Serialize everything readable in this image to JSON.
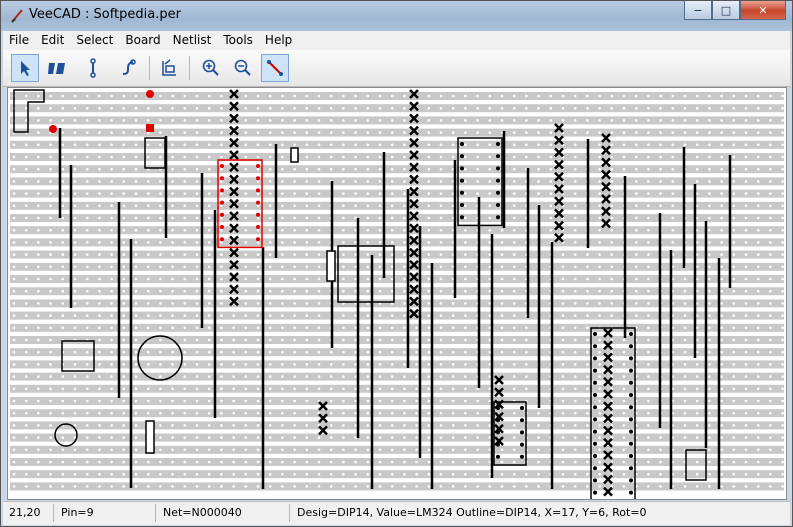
{
  "window": {
    "title": "VeeCAD : Softpedia.per"
  },
  "menu": [
    {
      "name": "menu-file",
      "label": "File"
    },
    {
      "name": "menu-edit",
      "label": "Edit"
    },
    {
      "name": "menu-select",
      "label": "Select"
    },
    {
      "name": "menu-board",
      "label": "Board"
    },
    {
      "name": "menu-netlist",
      "label": "Netlist"
    },
    {
      "name": "menu-tools",
      "label": "Tools"
    },
    {
      "name": "menu-help",
      "label": "Help"
    }
  ],
  "toolbar": {
    "tools": [
      "select-arrow-icon",
      "strip-break-icon",
      "link-icon",
      "wire-icon",
      "board-icon",
      "zoom-in-icon",
      "zoom-out-icon",
      "net-trace-icon"
    ],
    "active": "net-trace-icon"
  },
  "status": {
    "coords": "21,20",
    "pin": "Pin=9",
    "net": "Net=N000040",
    "component": "Desig=DIP14, Value=LM324 Outline=DIP14, X=17, Y=6, Rot=0"
  },
  "colors": {
    "strip": "#c8c8c8",
    "selected": "#e00000",
    "accent": "#2b5fb0"
  },
  "board": {
    "rows": 33,
    "links_x": [
      52,
      63,
      111,
      123,
      158,
      194,
      207,
      255,
      268,
      324,
      350,
      364,
      376,
      400,
      412,
      424,
      447,
      471,
      484,
      496,
      520,
      531,
      544,
      580,
      617,
      652,
      663,
      676,
      687,
      698,
      711,
      722
    ]
  }
}
